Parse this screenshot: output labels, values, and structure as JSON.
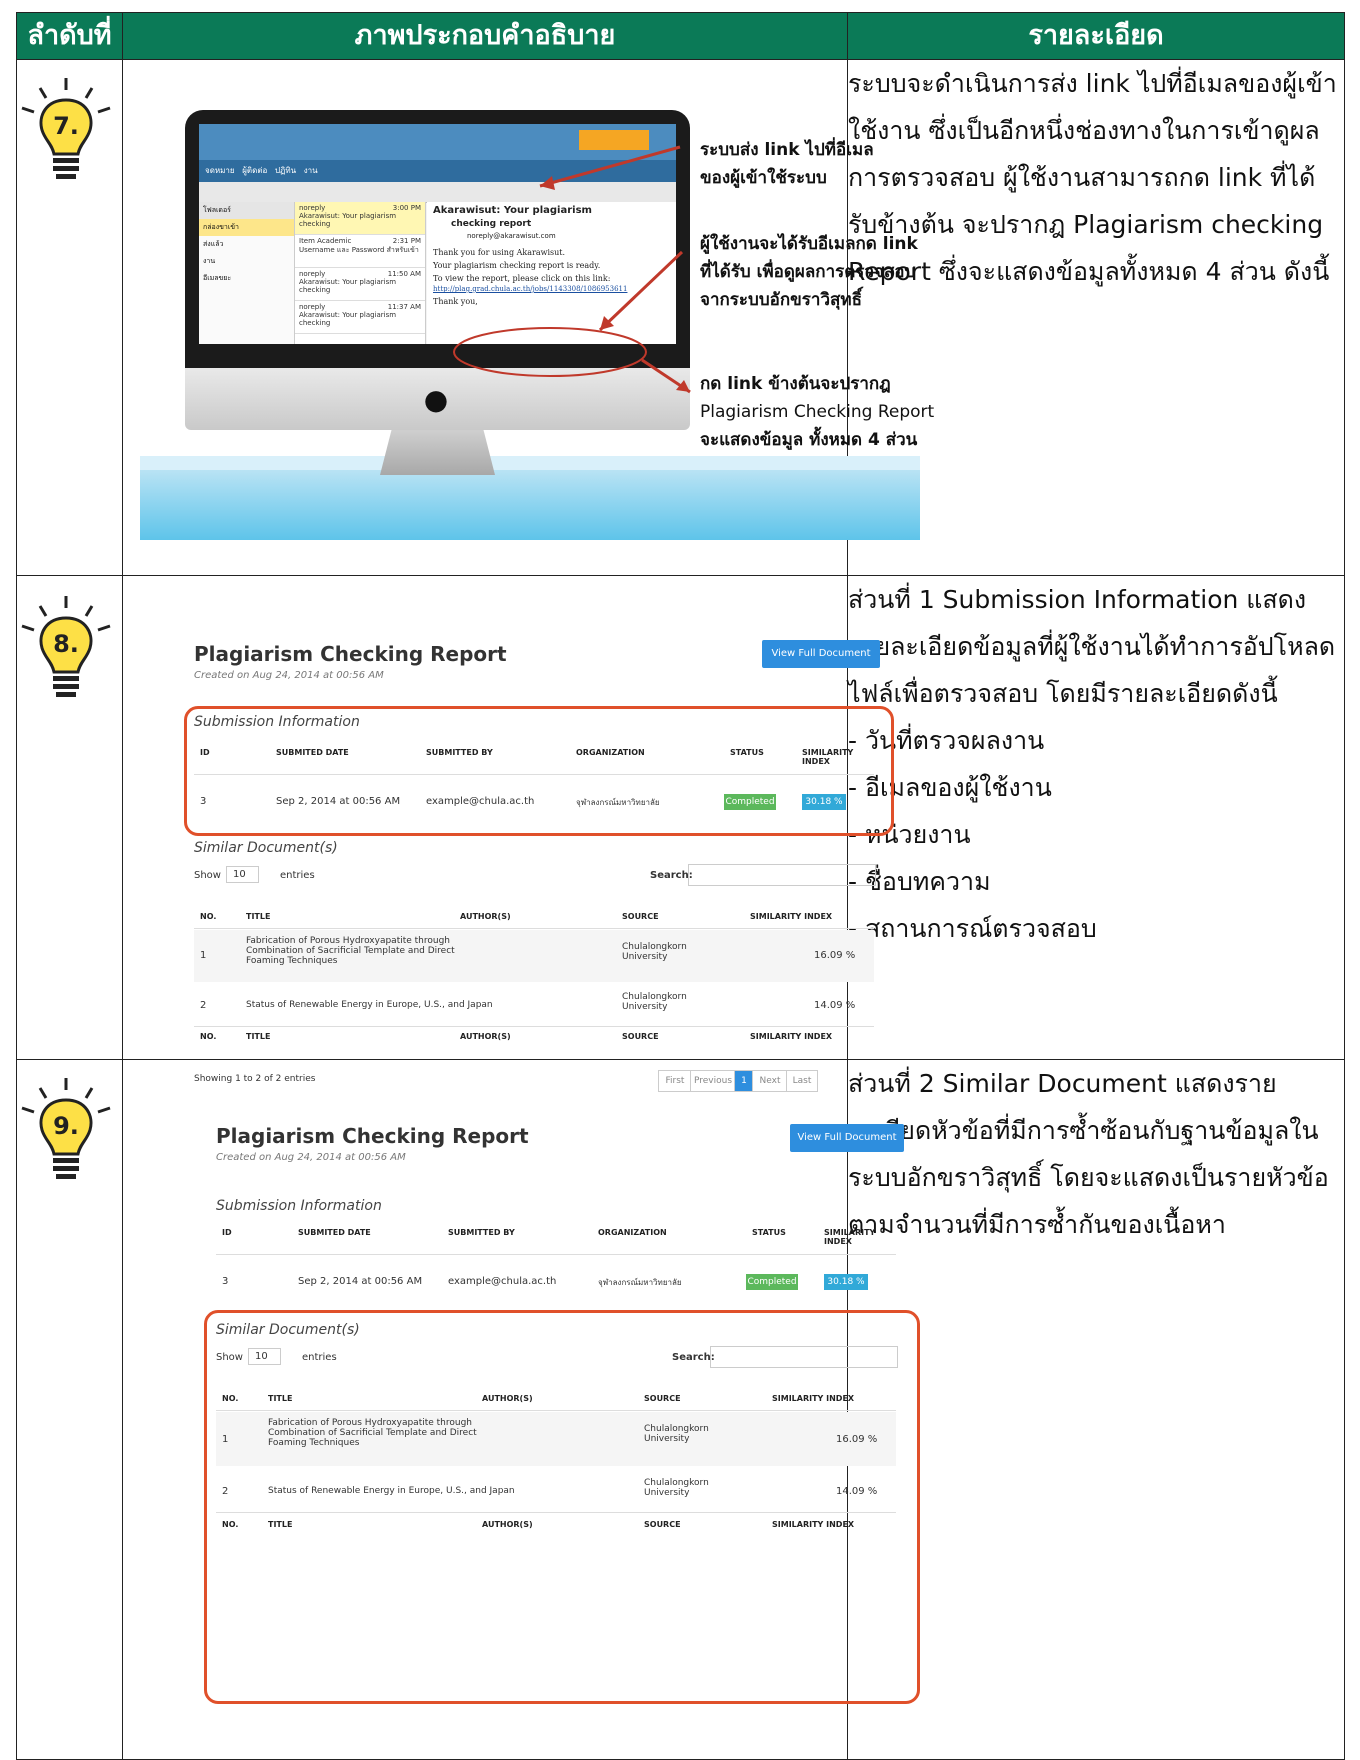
{
  "header": {
    "col1": "ลำดับที่",
    "col2": "ภาพประกอบคำอธิบาย",
    "col3": "รายละเอียด"
  },
  "rows": [
    {
      "step": "7.",
      "annotations": {
        "a1": "ระบบส่ง link ไปที่อีเมล",
        "a2": "ของผู้เข้าใช้ระบบ",
        "b1": "ผู้ใช้งานจะได้รับอีเมลกด link",
        "b2": "ที่ได้รับ เพื่อดูผลการตรวจสอบ",
        "b3": "จากระบบอักขราวิสุทธิ์",
        "c1": "กด link ข้างต้นจะปรากฎ",
        "c2": "Plagiarism Checking Report",
        "c3": "จะแสดงข้อมูล ทั้งหมด 4 ส่วน"
      },
      "screen": {
        "subject": "Akarawisut: Your plagiarism",
        "subject2": "checking report",
        "from": "noreply@akarawisut.com",
        "line1": "Thank you for using Akarawisut.",
        "line2": "Your plagiarism checking report is ready.",
        "line3": "To view the report, please click on this link:",
        "link": "http://plag.grad.chula.ac.th/jobs/1143308/1086953611",
        "line4": "Thank you,",
        "items": [
          {
            "from": "noreply",
            "time": "3:00 PM",
            "text": "Akarawisut: Your plagiarism checking"
          },
          {
            "from": "Item Academic",
            "time": "2:31 PM",
            "text": "Username และ Password สำหรับเข้า"
          },
          {
            "from": "noreply",
            "time": "11:50 AM",
            "text": "Akarawisut: Your plagiarism checking"
          },
          {
            "from": "noreply",
            "time": "11:37 AM",
            "text": "Akarawisut: Your plagiarism checking"
          }
        ]
      },
      "desc": "ระบบจะดำเนินการส่ง link ไปที่อีเมลของผู้เข้าใช้งาน ซึ่งเป็นอีกหนึ่งช่องทางในการเข้าดูผลการตรวจสอบ ผู้ใช้งานสามารถกด link ที่ได้รับข้างต้น จะปรากฎ Plagiarism checking Report ซึ่งจะแสดงข้อมูลทั้งหมด 4 ส่วน ดังนี้"
    },
    {
      "step": "8.",
      "desc": "ส่วนที่ 1 Submission Information แสดงรายละเอียดข้อมูลที่ผู้ใช้งานได้ทำการอัปโหลดไฟล์เพื่อตรวจสอบ โดยมีรายละเอียดดังนี้",
      "list": [
        "- วันที่ตรวจผลงาน",
        "- อีเมลของผู้ใช้งาน",
        "- หน่วยงาน",
        "- ชื่อบทความ",
        "- สถานการณ์ตรวจสอบ"
      ]
    },
    {
      "step": "9.",
      "desc": "ส่วนที่ 2 Similar Document แสดงรายละเอียดหัวข้อที่มีการซ้ำซ้อนกับฐานข้อมูลในระบบอักขราวิสุทธิ์ โดยจะแสดงเป็นรายหัวข้อตามจำนวนที่มีการซ้ำกันของเนื้อหา"
    }
  ],
  "report": {
    "title": "Plagiarism Checking Report",
    "created": "Created on Aug 24, 2014 at 00:56 AM",
    "view_full": "View Full Document",
    "submission_title": "Submission Information",
    "sub_headers": [
      "ID",
      "SUBMITED DATE",
      "SUBMITTED BY",
      "ORGANIZATION",
      "STATUS",
      "SIMILARITY INDEX"
    ],
    "sub_row": [
      "3",
      "Sep 2, 2014 at 00:56 AM",
      "example@chula.ac.th",
      "จุฬาลงกรณ์มหาวิทยาลัย",
      "Completed",
      "30.18 %"
    ],
    "similar_title": "Similar Document(s)",
    "show": "Show",
    "entries_val": "10",
    "entries": "entries",
    "search": "Search:",
    "doc_headers": [
      "NO.",
      "TITLE",
      "AUTHOR(S)",
      "SOURCE",
      "SIMILARITY INDEX"
    ],
    "docs": [
      {
        "no": "1",
        "title": "Fabrication of Porous Hydroxyapatite through Combination of Sacrificial Template and Direct Foaming Techniques",
        "source": "Chulalongkorn University",
        "sim": "16.09 %"
      },
      {
        "no": "2",
        "title": "Status of Renewable Energy in Europe, U.S., and Japan",
        "source": "Chulalongkorn University",
        "sim": "14.09 %"
      }
    ],
    "showing": "Showing 1 to 2 of 2 entries",
    "pager": [
      "First",
      "Previous",
      "1",
      "Next",
      "Last"
    ]
  }
}
